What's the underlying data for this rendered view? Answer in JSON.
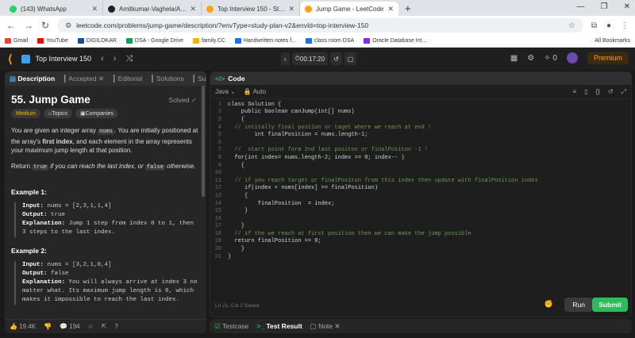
{
  "browser": {
    "tabs": [
      {
        "label": "(143) WhatsApp",
        "color": "#25d366"
      },
      {
        "label": "Amitkumar-Vaghela/AutoResu",
        "color": "#222222"
      },
      {
        "label": "Top Interview 150 - Study Plan",
        "color": "#ffa116"
      },
      {
        "label": "Jump Game - LeetCode",
        "color": "#ffa116"
      }
    ],
    "url": "leetcode.com/problems/jump-game/description/?envType=study-plan-v2&envId=top-interview-150",
    "bookmarks": [
      {
        "label": "Gmail",
        "color": "#ea4335"
      },
      {
        "label": "YouTube",
        "color": "#ff0000"
      },
      {
        "label": "DIGILOKAR",
        "color": "#1a4d8f"
      },
      {
        "label": "DSA - Google Drive",
        "color": "#0f9d58"
      },
      {
        "label": "family.CC",
        "color": "#f4b400"
      },
      {
        "label": "Handwritten notes f...",
        "color": "#1a73e8"
      },
      {
        "label": "class room DSA",
        "color": "#1a73e8"
      },
      {
        "label": "Oracle Database Int...",
        "color": "#8a2be2"
      }
    ],
    "all_bookmarks": "All Bookmarks"
  },
  "header": {
    "plan": "Top Interview 150",
    "timer": "00:17:20",
    "coins": "0",
    "premium": "Premium"
  },
  "left": {
    "tabs": [
      "Description",
      "Accepted",
      "Editorial",
      "Solutions",
      "Subm"
    ],
    "title": "55. Jump Game",
    "solved": "Solved",
    "difficulty": "Medium",
    "topics": "Topics",
    "companies": "Companies",
    "desc1_a": "You are given an integer array ",
    "desc1_code": "nums",
    "desc1_b": ". You are initially positioned at the array's ",
    "desc1_bold": "first index",
    "desc1_c": ", and each element in the array represents your maximum jump length at that position.",
    "desc2_a": "Return ",
    "desc2_code1": "true",
    "desc2_b": " if you can reach the last index, or ",
    "desc2_code2": "false",
    "desc2_c": " otherwise.",
    "example1": {
      "heading": "Example 1:",
      "input": "nums = [2,3,1,1,4]",
      "output": "true",
      "explanation": "Jump 1 step from index 0 to 1, then 3 steps to the last index."
    },
    "example2": {
      "heading": "Example 2:",
      "input": "nums = [3,2,1,0,4]",
      "output": "false",
      "explanation": "You will always arrive at index 3 no matter what. Its maximum jump length is 0, which makes it impossible to reach the last index."
    },
    "labels": {
      "input": "Input:",
      "output": "Output:",
      "explanation": "Explanation:"
    },
    "likes": "19.4K",
    "comments": "194"
  },
  "right": {
    "tab": "Code",
    "language": "Java",
    "auto": "Auto",
    "code_lines": [
      "class Solution {",
      "    public boolean canJump(int[] nums)",
      "    {",
      "  // intitally final postion or taget where we reach at end !",
      "        int finalPosition = nums.length-1;",
      "",
      "  //  start point form 2nd last positon or finalPositon -1 !",
      "  for(int index= nums.length-2; index >= 0; index-- )",
      "    {",
      "",
      "  // if you reach target or finalPositon from this index then update with finalPosition index",
      "     if(index + nums[index] >= finalPosition)",
      "     {",
      "         finalPosition  = index;",
      "     }",
      "",
      "    }",
      "  // if the we reach at first position then we can make the jump possible",
      "  return finalPosition == 0;",
      "    }",
      "}"
    ],
    "status": "Ln 21, Col 2   Saved",
    "run": "Run",
    "submit": "Submit"
  },
  "bottom": {
    "testcase": "Testcase",
    "test_result": "Test Result",
    "note": "Note"
  }
}
